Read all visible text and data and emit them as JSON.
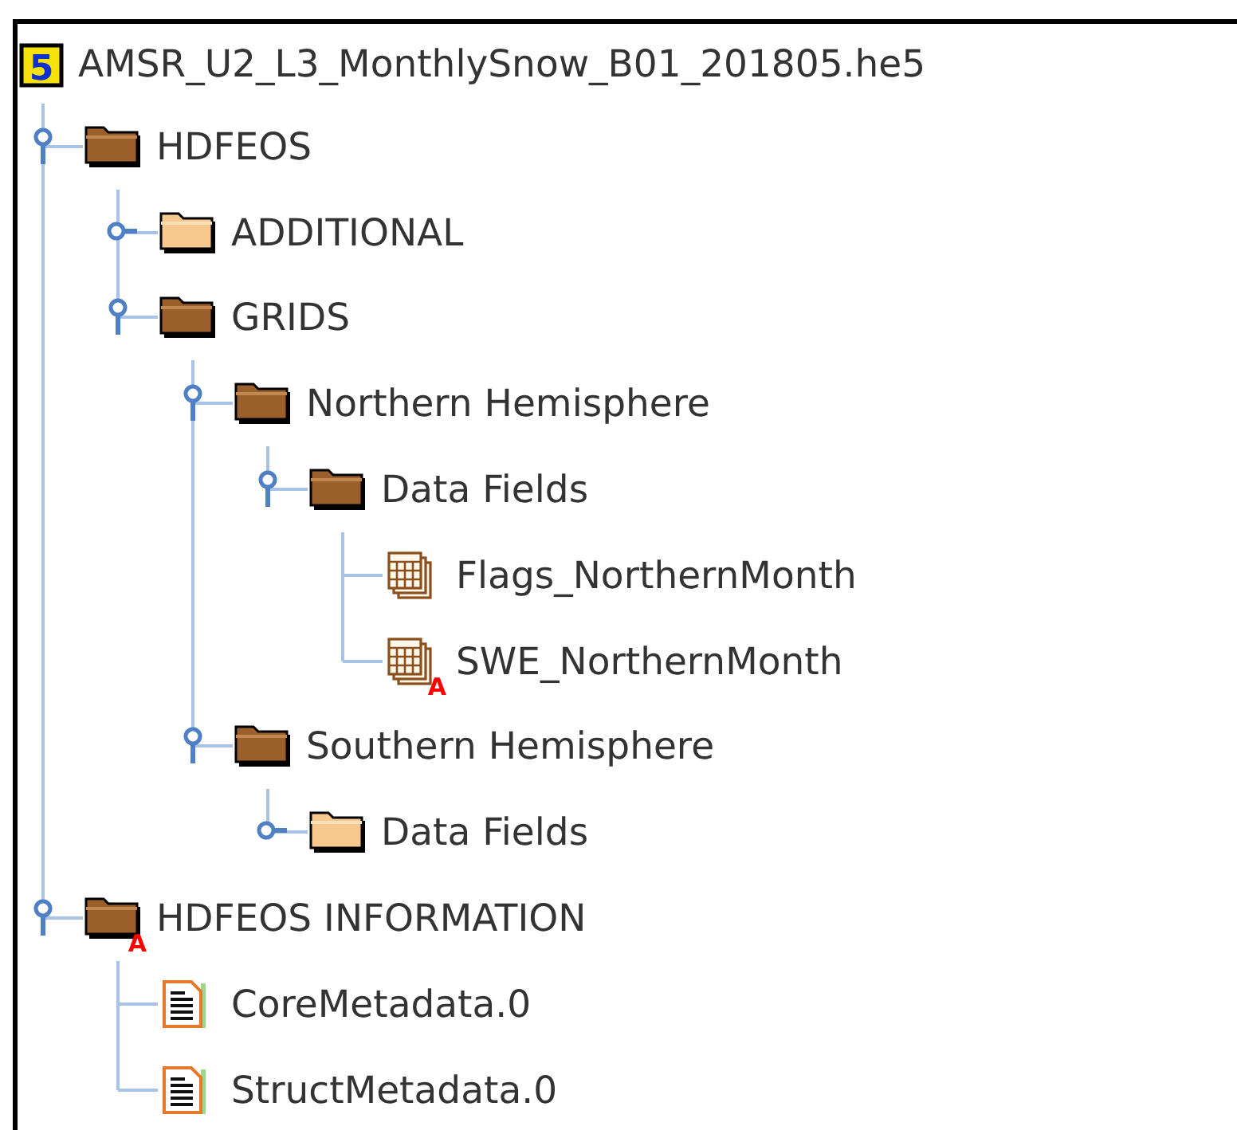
{
  "file": {
    "name": "AMSR_U2_L3_MonthlySnow_B01_201805.he5",
    "icon_text": "5",
    "children": [
      {
        "label": "HDFEOS",
        "kind": "group",
        "expanded": true,
        "children": [
          {
            "label": "ADDITIONAL",
            "kind": "group",
            "expanded": false
          },
          {
            "label": "GRIDS",
            "kind": "group",
            "expanded": true,
            "children": [
              {
                "label": "Northern Hemisphere",
                "kind": "group",
                "expanded": true,
                "children": [
                  {
                    "label": "Data Fields",
                    "kind": "group",
                    "expanded": true,
                    "children": [
                      {
                        "label": "Flags_NorthernMonth",
                        "kind": "dataset"
                      },
                      {
                        "label": "SWE_NorthernMonth",
                        "kind": "dataset",
                        "attribute_badge": "A"
                      }
                    ]
                  }
                ]
              },
              {
                "label": "Southern Hemisphere",
                "kind": "group",
                "expanded": true,
                "children": [
                  {
                    "label": "Data Fields",
                    "kind": "group",
                    "expanded": false
                  }
                ]
              }
            ]
          }
        ]
      },
      {
        "label": "HDFEOS INFORMATION",
        "kind": "group",
        "expanded": true,
        "attribute_badge": "A",
        "children": [
          {
            "label": "CoreMetadata.0",
            "kind": "text"
          },
          {
            "label": "StructMetadata.0",
            "kind": "text"
          }
        ]
      }
    ]
  }
}
